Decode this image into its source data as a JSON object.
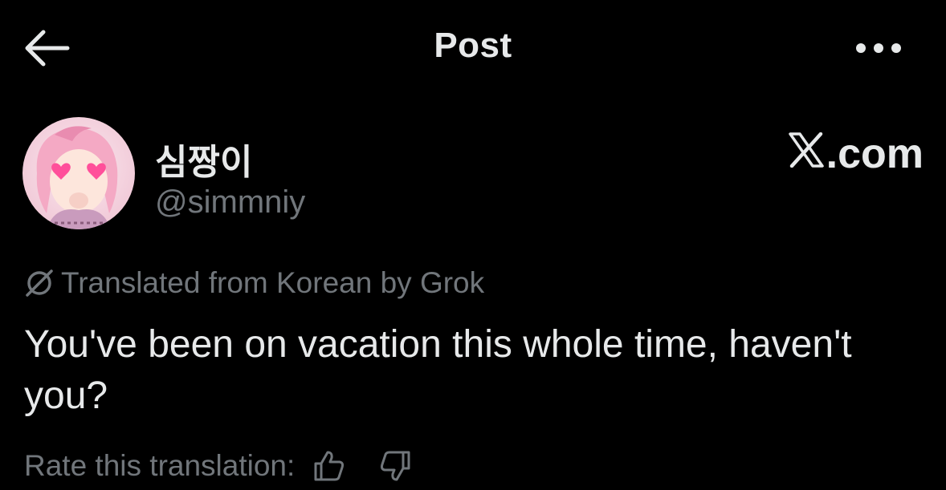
{
  "header": {
    "title": "Post",
    "back_icon": "arrow-left-icon",
    "more_icon": "more-horizontal-icon"
  },
  "author": {
    "display_name": "심짱이",
    "handle": "@simmniy",
    "avatar_icon": "avatar-anime-character"
  },
  "brand": {
    "text": ".com",
    "icon": "x-logo-icon"
  },
  "translation": {
    "notice": "Translated from Korean by Grok",
    "notice_icon": "slashed-circle-icon"
  },
  "post": {
    "text": "You've been on vacation this whole time, haven't you?"
  },
  "rating": {
    "label": "Rate this translation:",
    "up_icon": "thumbs-up-icon",
    "down_icon": "thumbs-down-icon"
  },
  "colors": {
    "background": "#000000",
    "primary_text": "#e7e9ea",
    "secondary_text": "#71767b"
  }
}
